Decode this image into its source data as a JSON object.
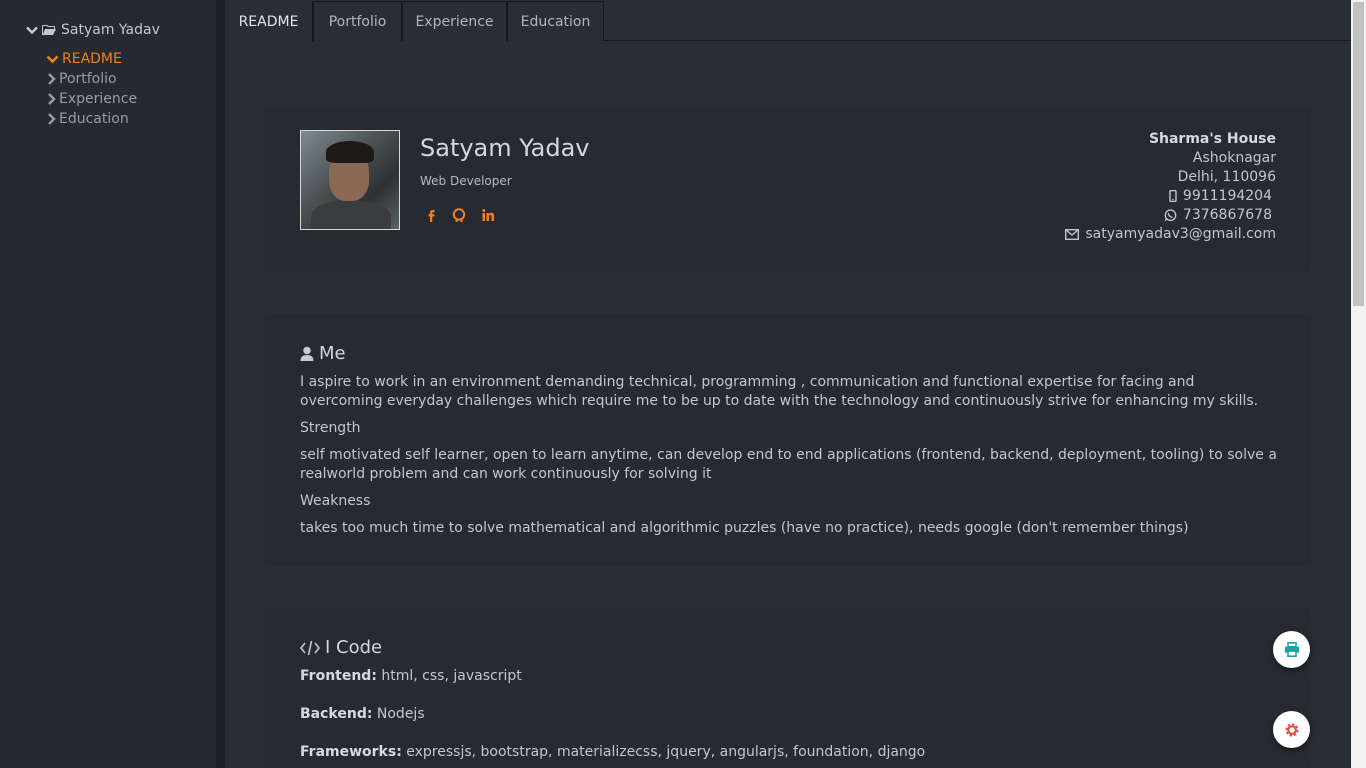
{
  "sidebar": {
    "root_label": "Satyam Yadav",
    "items": [
      {
        "label": "README",
        "active": true
      },
      {
        "label": "Portfolio",
        "active": false
      },
      {
        "label": "Experience",
        "active": false
      },
      {
        "label": "Education",
        "active": false
      }
    ]
  },
  "tabs": [
    {
      "label": "README",
      "active": true
    },
    {
      "label": "Portfolio",
      "active": false
    },
    {
      "label": "Experience",
      "active": false
    },
    {
      "label": "Education",
      "active": false
    }
  ],
  "profile": {
    "name": "Satyam Yadav",
    "role": "Web Developer",
    "social_icons": [
      "facebook-icon",
      "github-icon",
      "linkedin-icon"
    ]
  },
  "contact": {
    "address_line1": "Sharma's House",
    "address_line2": "Ashoknagar",
    "address_line3": "Delhi, 110096",
    "phone": "9911194204",
    "whatsapp": "7376867678",
    "email": "satyamyadav3@gmail.com"
  },
  "me": {
    "title": "Me",
    "intro": "I aspire to work in an environment demanding technical, programming , communication and functional expertise for facing and overcoming everyday challenges which require me to be up to date with the technology and continuously strive for enhancing my skills.",
    "strength_label": "Strength",
    "strength_text": "self motivated self learner, open to learn anytime, can develop end to end applications (frontend, backend, deployment, tooling) to solve a realworld problem and can work continuously for solving it",
    "weakness_label": "Weakness",
    "weakness_text": "takes too much time to solve mathematical and algorithmic puzzles (have no practice), needs google (don't remember things)"
  },
  "code": {
    "title": "I Code",
    "frontend_label": "Frontend:",
    "frontend_value": "html, css, javascript",
    "backend_label": "Backend:",
    "backend_value": "Nodejs",
    "frameworks_label": "Frameworks:",
    "frameworks_value": "expressjs, bootstrap, materializecss, jquery, angularjs, foundation, django"
  },
  "colors": {
    "accent": "#f0801f",
    "background": "#2a2d35",
    "sidebar": "#262930",
    "print_icon": "#1aa3a3",
    "settings_icon": "#e74c3c"
  },
  "fabs": [
    "print-icon",
    "gear-icon"
  ]
}
